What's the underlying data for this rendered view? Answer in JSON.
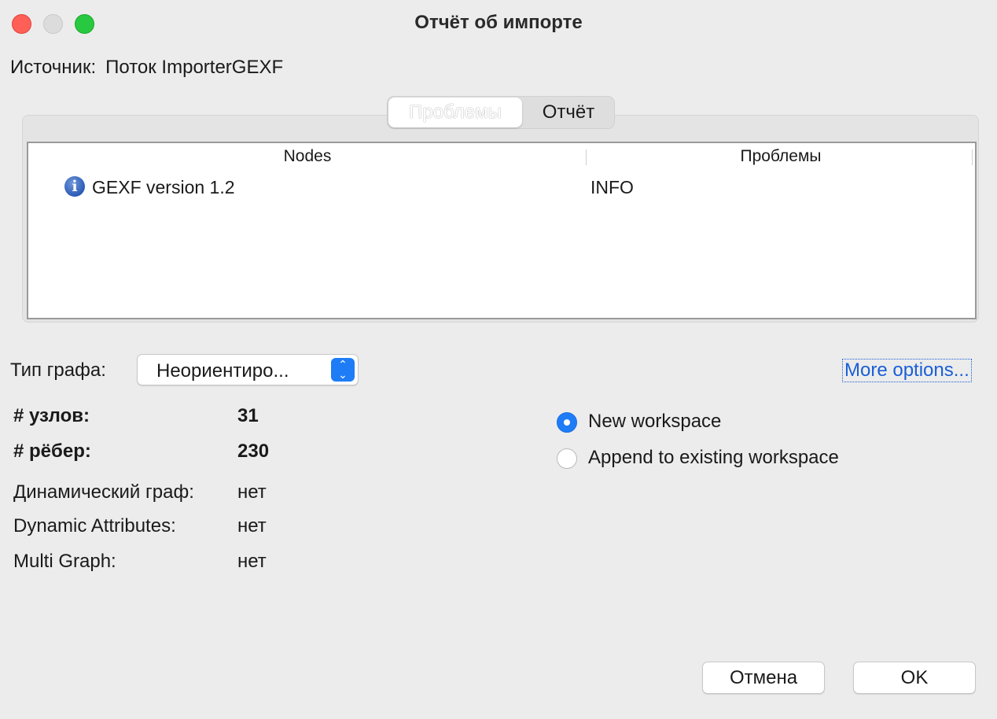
{
  "window": {
    "title": "Отчёт об импорте"
  },
  "source": {
    "label": "Источник:",
    "value": "Поток ImporterGEXF"
  },
  "tabs": [
    {
      "label": "Проблемы",
      "selected": true
    },
    {
      "label": "Отчёт",
      "selected": false
    }
  ],
  "issues_table": {
    "columns": [
      "Nodes",
      "Проблемы"
    ],
    "rows": [
      {
        "icon": "info-icon",
        "message": "GEXF version 1.2",
        "level": "INFO"
      }
    ]
  },
  "graph_type": {
    "label": "Тип графа:",
    "selected": "Неориентиро..."
  },
  "more_options": "More options...",
  "stats": {
    "nodes_label": "# узлов:",
    "nodes_value": "31",
    "edges_label": "# рёбер:",
    "edges_value": "230",
    "dynamic_graph_label": "Динамический граф:",
    "dynamic_graph_value": "нет",
    "dynamic_attributes_label": "Dynamic Attributes:",
    "dynamic_attributes_value": "нет",
    "multi_graph_label": "Multi Graph:",
    "multi_graph_value": "нет"
  },
  "workspace": {
    "new_label": "New workspace",
    "append_label": "Append to existing workspace",
    "selected": "new"
  },
  "buttons": {
    "cancel": "Отмена",
    "ok": "OK"
  },
  "colors": {
    "accent": "#1e7cf7",
    "link": "#1a5fd6",
    "close": "#fe5f57",
    "maximize": "#28c840"
  }
}
